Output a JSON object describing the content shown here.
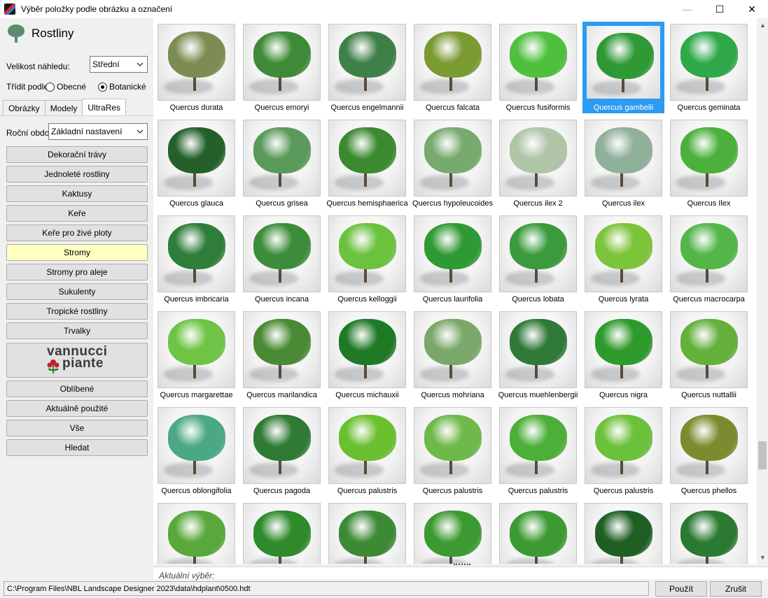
{
  "window": {
    "title": "Výběr položky podle obrázku a označení",
    "min_glyph": "—",
    "max_glyph": "☐",
    "close_glyph": "✕"
  },
  "left_panel": {
    "title": "Rostliny",
    "preview_size_label": "Velikost náhledu:",
    "preview_size_value": "Střední",
    "sort_label": "Třídit podle",
    "sort_options": [
      {
        "label": "Obecné",
        "selected": false
      },
      {
        "label": "Botanické",
        "selected": true
      }
    ],
    "tabs": [
      {
        "label": "Obrázky",
        "active": false
      },
      {
        "label": "Modely",
        "active": false
      },
      {
        "label": "UltraRes",
        "active": true
      }
    ],
    "season_label": "Roční období",
    "season_value": "Základní nastavení",
    "categories": [
      {
        "label": "Dekorační trávy",
        "active": false
      },
      {
        "label": "Jednoleté rostliny",
        "active": false
      },
      {
        "label": "Kaktusy",
        "active": false
      },
      {
        "label": "Keře",
        "active": false
      },
      {
        "label": "Keře pro živé ploty",
        "active": false
      },
      {
        "label": "Stromy",
        "active": true
      },
      {
        "label": "Stromy pro aleje",
        "active": false
      },
      {
        "label": "Sukulenty",
        "active": false
      },
      {
        "label": "Tropické rostliny",
        "active": false
      },
      {
        "label": "Trvalky",
        "active": false
      }
    ],
    "brand": {
      "line1": "vannucci",
      "line2": "piante"
    },
    "extra_buttons": [
      {
        "label": "Oblíbené"
      },
      {
        "label": "Aktuálně použité"
      },
      {
        "label": "Vše"
      },
      {
        "label": "Hledat"
      }
    ]
  },
  "grid": {
    "items": [
      {
        "label": "Quercus durata",
        "color": "#7d8c52"
      },
      {
        "label": "Quercus emoryi",
        "color": "#3f8a36"
      },
      {
        "label": "Quercus engelmannii",
        "color": "#3f7f48"
      },
      {
        "label": "Quercus falcata",
        "color": "#7a9a32"
      },
      {
        "label": "Quercus fusiformis",
        "color": "#4fc03e"
      },
      {
        "label": "Quercus gambelii",
        "color": "#2f9a35",
        "selected": true
      },
      {
        "label": "Quercus geminata",
        "color": "#2fa84a"
      },
      {
        "label": "Quercus glauca",
        "color": "#23602a"
      },
      {
        "label": "Quercus grisea",
        "color": "#5a9a5a"
      },
      {
        "label": "Quercus hemisphaerica",
        "color": "#3b8a30"
      },
      {
        "label": "Quercus hypoleucoides",
        "color": "#78aa6e"
      },
      {
        "label": "Quercus ilex 2",
        "color": "#b0c4a8"
      },
      {
        "label": "Quercus ilex",
        "color": "#8fb09a"
      },
      {
        "label": "Quercus Ilex",
        "color": "#4cb13c"
      },
      {
        "label": "Quercus imbricaria",
        "color": "#2e7d3a"
      },
      {
        "label": "Quercus incana",
        "color": "#3d8c3a"
      },
      {
        "label": "Quercus kelloggii",
        "color": "#6ac23e"
      },
      {
        "label": "Quercus laurifolia",
        "color": "#2f9a34"
      },
      {
        "label": "Quercus lobata",
        "color": "#3a9a3c"
      },
      {
        "label": "Quercus lyrata",
        "color": "#7cc43a"
      },
      {
        "label": "Quercus macrocarpa",
        "color": "#52b648"
      },
      {
        "label": "Quercus margarettae",
        "color": "#6ec444"
      },
      {
        "label": "Quercus marilandica",
        "color": "#4a8a34"
      },
      {
        "label": "Quercus michauxii",
        "color": "#1f7a26"
      },
      {
        "label": "Quercus mohriana",
        "color": "#7aa86a"
      },
      {
        "label": "Quercus muehlenbergii",
        "color": "#2f7a38"
      },
      {
        "label": "Quercus nigra",
        "color": "#2f9a2c"
      },
      {
        "label": "Quercus nuttallii",
        "color": "#64b03a"
      },
      {
        "label": "Quercus oblongifolia",
        "color": "#4aa884"
      },
      {
        "label": "Quercus pagoda",
        "color": "#2f7a34"
      },
      {
        "label": "Quercus palustris",
        "color": "#6ac02e"
      },
      {
        "label": "Quercus palustris",
        "color": "#6fb84a"
      },
      {
        "label": "Quercus palustris",
        "color": "#4caf38"
      },
      {
        "label": "Quercus palustris",
        "color": "#6cc13a"
      },
      {
        "label": "Quercus phellos",
        "color": "#7a8c2e"
      },
      {
        "label": "",
        "color": "#58a83a"
      },
      {
        "label": "",
        "color": "#2e8a2a"
      },
      {
        "label": "",
        "color": "#3d8a36"
      },
      {
        "label": "",
        "color": "#3c9a32"
      },
      {
        "label": "",
        "color": "#3c9a32"
      },
      {
        "label": "",
        "color": "#1f5f24"
      },
      {
        "label": "",
        "color": "#2a7a32"
      }
    ]
  },
  "current_selection_label": "Aktuální výběr:",
  "status": {
    "path": "C:\\Program Files\\NBL Landscape Designer 2023\\data\\hdplant\\0500.hdt",
    "apply_label": "Použít",
    "cancel_label": "Zrušit"
  }
}
